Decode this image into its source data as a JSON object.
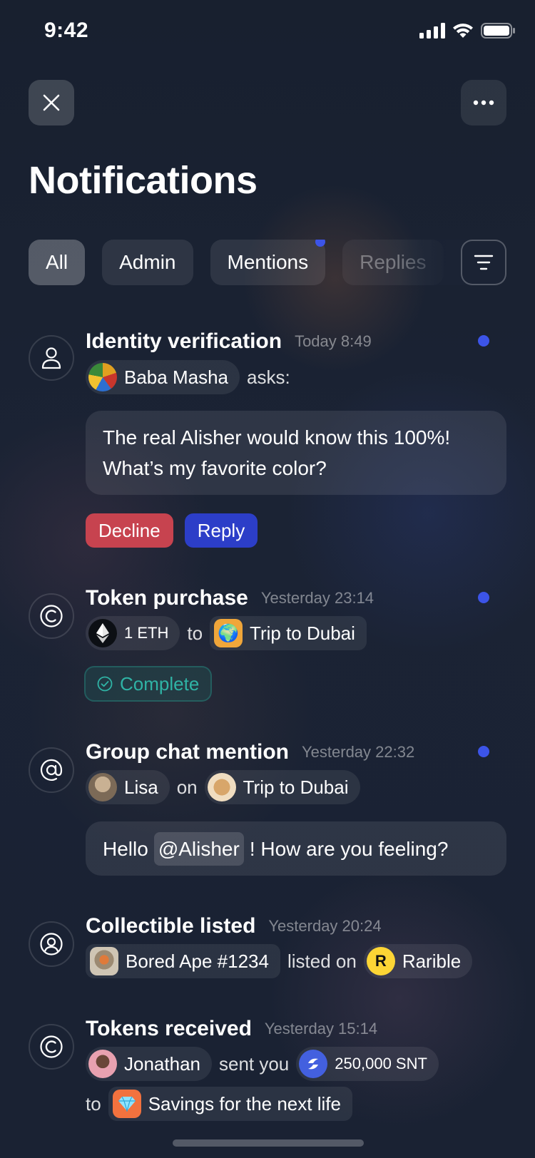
{
  "status_bar": {
    "time": "9:42"
  },
  "page": {
    "title": "Notifications"
  },
  "tabs": [
    {
      "label": "All"
    },
    {
      "label": "Admin"
    },
    {
      "label": "Mentions"
    },
    {
      "label": "Replies"
    }
  ],
  "notifications": [
    {
      "title": "Identity verification",
      "time": "Today 8:49",
      "user": "Baba Masha",
      "text_after": "asks:",
      "message": "The real Alisher would know this 100%! What’s my favorite color?",
      "decline_label": "Decline",
      "reply_label": "Reply"
    },
    {
      "title": "Token purchase",
      "time": "Yesterday 23:14",
      "amount": "1 ETH",
      "connector": "to",
      "community": "Trip to Dubai",
      "status": "Complete"
    },
    {
      "title": "Group chat mention",
      "time": "Yesterday 22:32",
      "user": "Lisa",
      "connector": "on",
      "community": "Trip to Dubai",
      "message_before": "Hello",
      "mention": "@Alisher",
      "message_after": "! How are you feeling?"
    },
    {
      "title": "Collectible listed",
      "time": "Yesterday 20:24",
      "collectible": "Bored Ape #1234",
      "connector": "listed on",
      "marketplace": "Rarible",
      "marketplace_logo": "R"
    },
    {
      "title": "Tokens received",
      "time": "Yesterday 15:14",
      "user": "Jonathan",
      "connector": "sent you",
      "amount": "250,000 SNT",
      "connector2": "to",
      "account": "Savings for the next life"
    }
  ],
  "colors": {
    "unread": "#3c54e8",
    "decline": "#c7434f",
    "reply": "#2c3ec8",
    "complete": "#2fb3a5"
  }
}
